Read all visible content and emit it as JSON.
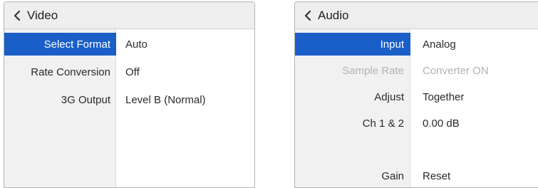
{
  "video_panel": {
    "title": "Video",
    "rows": [
      {
        "label": "Select Format",
        "value": "Auto"
      },
      {
        "label": "Rate Conversion",
        "value": "Off"
      },
      {
        "label": "3G Output",
        "value": "Level B (Normal)"
      }
    ]
  },
  "audio_panel": {
    "title": "Audio",
    "rows": [
      {
        "label": "Input",
        "value": "Analog"
      },
      {
        "label": "Sample Rate",
        "value": "Converter ON"
      },
      {
        "label": "Adjust",
        "value": "Together"
      },
      {
        "label": "Ch 1 & 2",
        "value": "0.00 dB"
      },
      {
        "label": "Gain",
        "value": "Reset"
      }
    ]
  },
  "colors": {
    "selected_background": "#1a5fc8",
    "disabled_text": "#b3b3b3",
    "header_background": "#eeeeee"
  },
  "icons": {
    "back": "chevron-left-icon"
  }
}
